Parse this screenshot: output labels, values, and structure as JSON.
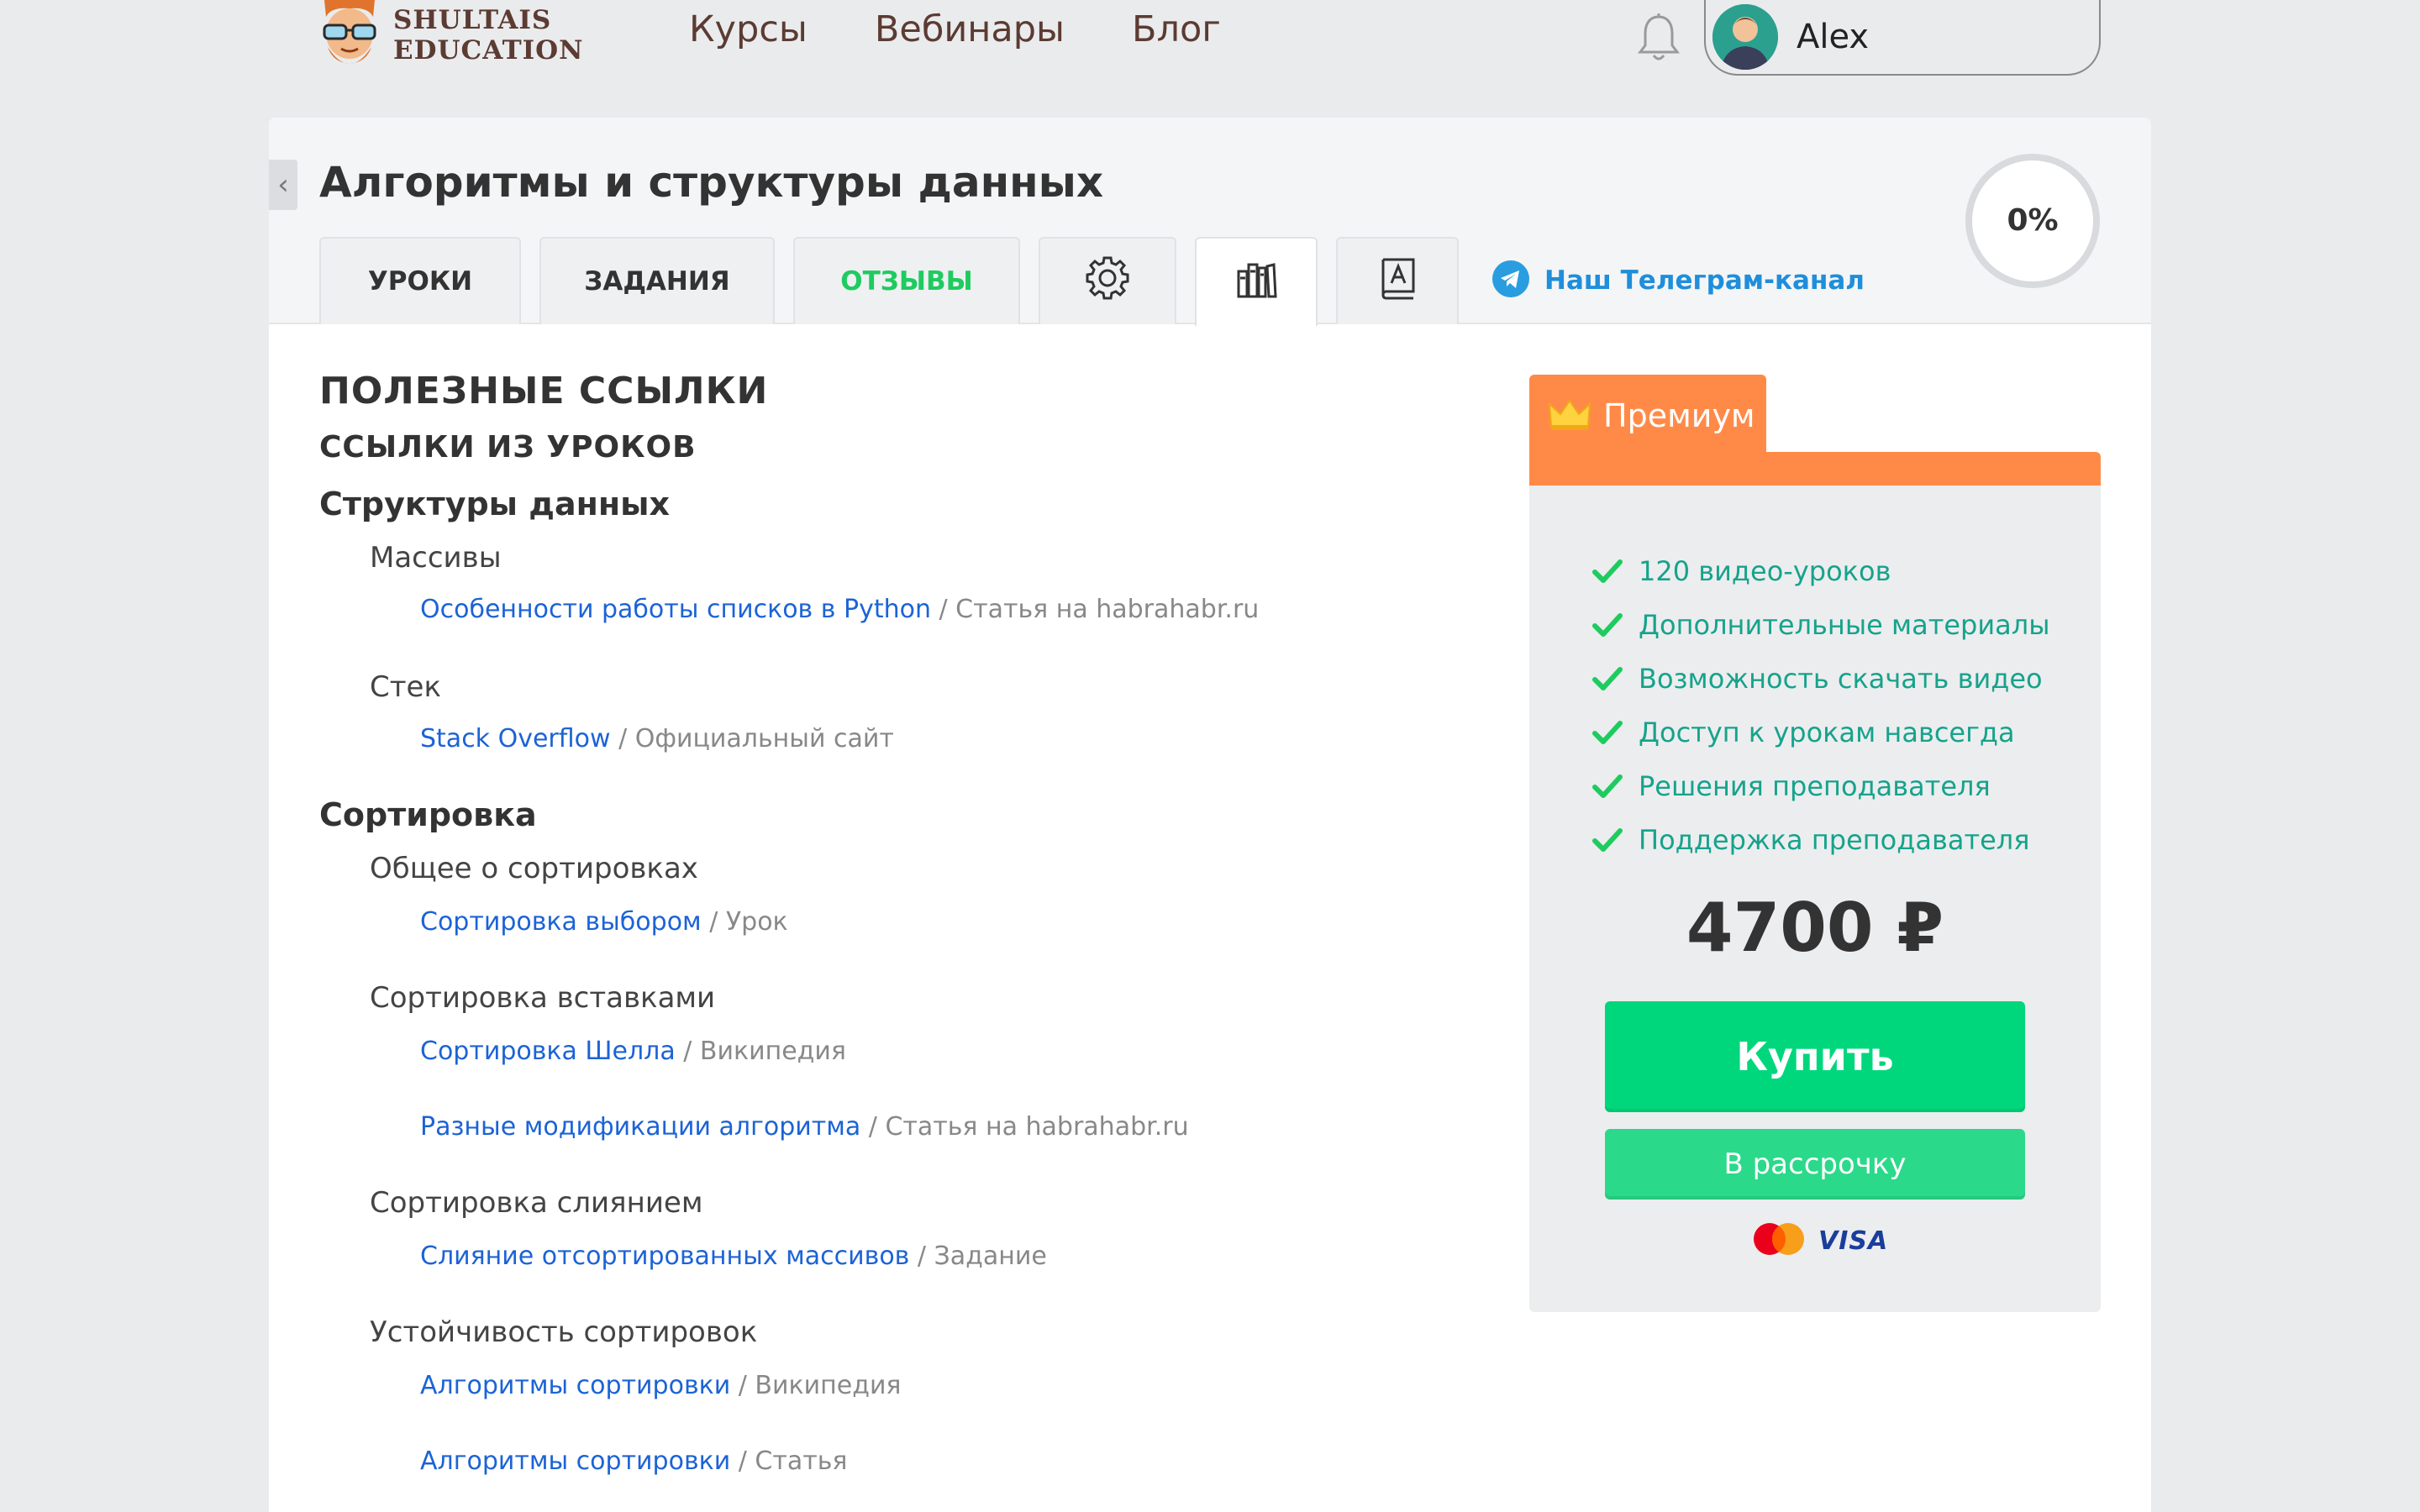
{
  "header": {
    "logo_line1": "SHULTAIS",
    "logo_line2": "EDUCATION",
    "nav": [
      "Курсы",
      "Вебинары",
      "Блог"
    ],
    "user_name": "Alex"
  },
  "course": {
    "title": "Алгоритмы и структуры данных",
    "progress": "0%",
    "progress_value": 0,
    "tabs": {
      "lessons": "УРОКИ",
      "tasks": "ЗАДАНИЯ",
      "reviews": "ОТЗЫВЫ",
      "settings_icon": "gear-icon",
      "library_icon": "books-icon",
      "dictionary_icon": "dictionary-icon"
    },
    "telegram": "Наш Телеграм-канал"
  },
  "links": {
    "title": "ПОЛЕЗНЫЕ ССЫЛКИ",
    "subtitle": "ССЫЛКИ ИЗ УРОКОВ",
    "sections": [
      {
        "name": "Структуры данных",
        "topics": [
          {
            "name": "Массивы",
            "links": [
              {
                "text": "Особенности работы списков в Python",
                "source": " / Статья на habrahabr.ru"
              }
            ]
          },
          {
            "name": "Стек",
            "links": [
              {
                "text": "Stack Overflow",
                "source": " / Официальный сайт"
              }
            ]
          }
        ]
      },
      {
        "name": "Сортировка",
        "topics": [
          {
            "name": "Общее о сортировках",
            "links": [
              {
                "text": "Сортировка выбором",
                "source": " / Урок"
              }
            ]
          },
          {
            "name": "Сортировка вставками",
            "links": [
              {
                "text": "Сортировка Шелла",
                "source": " / Википедия"
              },
              {
                "text": "Разные модификации алгоритма",
                "source": " / Статья на habrahabr.ru"
              }
            ]
          },
          {
            "name": "Сортировка слиянием",
            "links": [
              {
                "text": "Слияние отсортированных массивов",
                "source": " / Задание"
              }
            ]
          },
          {
            "name": "Устойчивость сортировок",
            "links": [
              {
                "text": "Алгоритмы сортировки",
                "source": " / Википедия"
              },
              {
                "text": "Алгоритмы сортировки",
                "source": " / Статья"
              }
            ]
          }
        ]
      }
    ]
  },
  "premium": {
    "label": "Премиум",
    "features": [
      "120 видео-уроков",
      "Дополнительные материалы",
      "Возможность скачать видео",
      "Доступ к урокам навсегда",
      "Решения преподавателя",
      "Поддержка преподавателя"
    ],
    "price": "4700 ₽",
    "buy": "Купить",
    "installment": "В рассрочку",
    "payment_brand": "VISA",
    "colors": {
      "accent_orange": "#ff8a47",
      "buy_green": "#00d77c",
      "feature_green": "#16a38b"
    }
  }
}
